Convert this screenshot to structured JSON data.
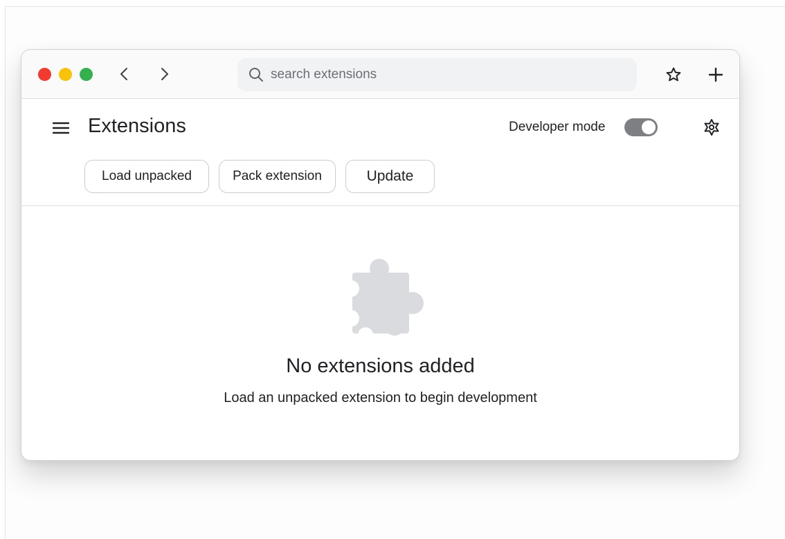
{
  "toolbar": {
    "search_placeholder": "search extensions",
    "icons": {
      "back": "chevron-left-icon",
      "forward": "chevron-right-icon",
      "search": "search-icon",
      "bookmark": "star-icon",
      "new_tab": "plus-icon"
    }
  },
  "window_controls": {
    "close_color": "#f23b30",
    "minimize_color": "#f8c30a",
    "maximize_color": "#34b04f"
  },
  "header": {
    "title": "Extensions",
    "developer_mode_label": "Developer mode",
    "developer_mode_on": true,
    "icons": {
      "menu": "hamburger-menu-icon",
      "settings": "gear-icon"
    }
  },
  "actions": {
    "load_unpacked": "Load unpacked",
    "pack_extension": "Pack extension",
    "update": "Update"
  },
  "empty_state": {
    "icon": "puzzle-piece-icon",
    "title": "No extensions added",
    "subtitle": "Load an unpacked extension to begin development"
  }
}
